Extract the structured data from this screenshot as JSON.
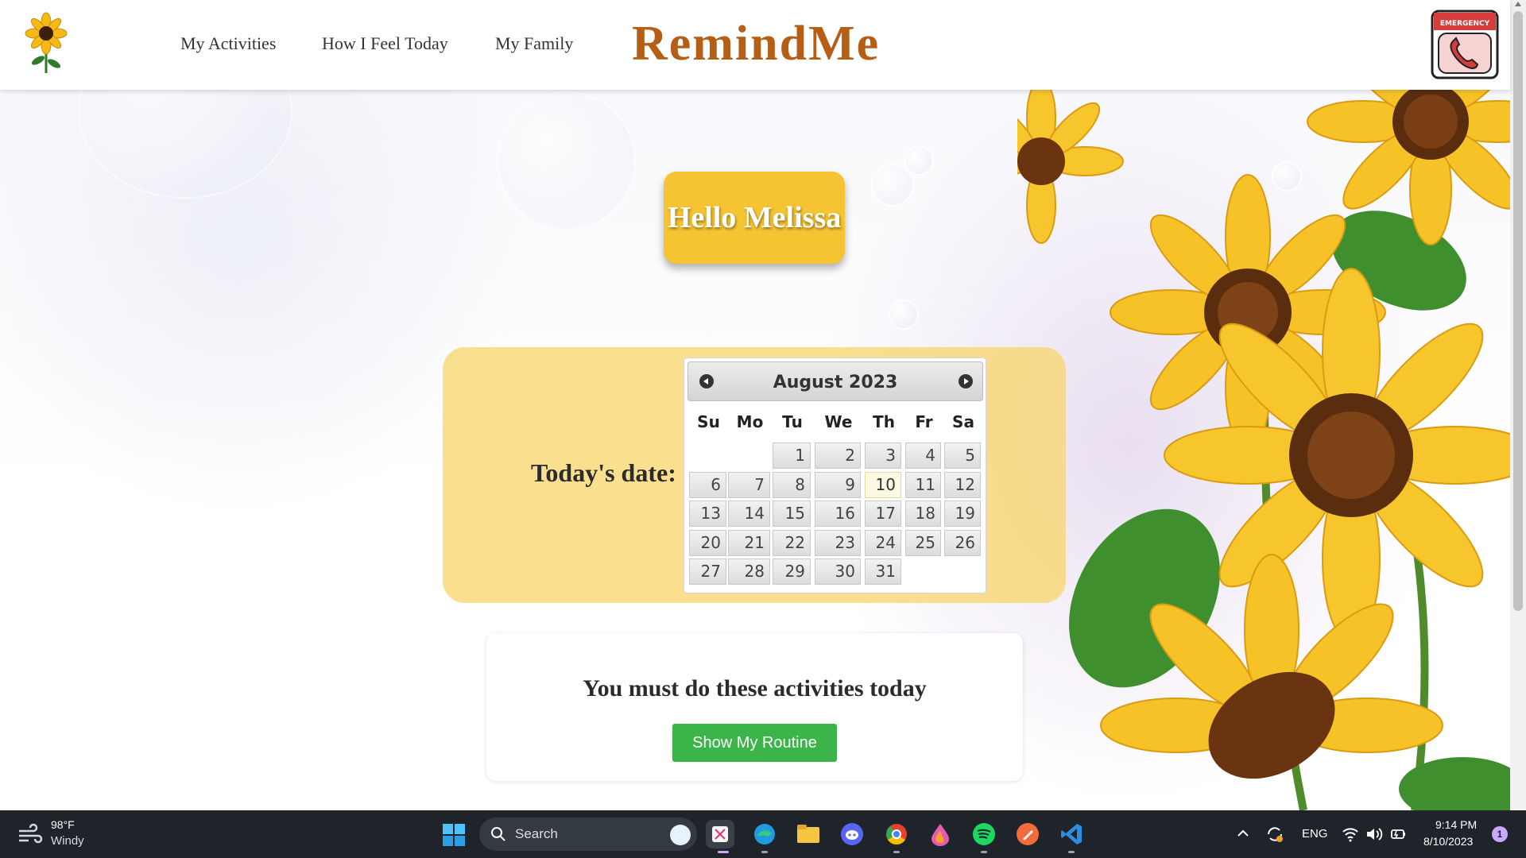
{
  "app": {
    "brand": "RemindMe"
  },
  "nav": {
    "items": [
      {
        "label": "My Activities"
      },
      {
        "label": "How I Feel Today"
      },
      {
        "label": "My Family"
      }
    ],
    "emergency_label": "EMERGENCY"
  },
  "greeting": "Hello Melissa",
  "date_section": {
    "label": "Today's date:",
    "calendar": {
      "month_year": "August 2023",
      "weekdays": [
        "Su",
        "Mo",
        "Tu",
        "We",
        "Th",
        "Fr",
        "Sa"
      ],
      "first_weekday_index": 2,
      "days_in_month": 31,
      "today": 10
    }
  },
  "activities": {
    "title": "You must do these activities today",
    "button_label": "Show My Routine"
  },
  "taskbar": {
    "weather_temp": "98°F",
    "weather_condition": "Windy",
    "search_placeholder": "Search",
    "language": "ENG",
    "time": "9:14 PM",
    "date": "8/10/2023",
    "notification_count": "1",
    "apps": [
      "snipping-tool",
      "edge",
      "file-explorer",
      "discord",
      "chrome",
      "paint-drop",
      "spotify",
      "brave-pen",
      "vscode"
    ]
  },
  "colors": {
    "brand": "#b55e15",
    "hello_bg": "#f6c332",
    "panel_bg": "#f8d670",
    "button_green": "#3bb54a",
    "taskbar_bg": "#1f242b"
  }
}
